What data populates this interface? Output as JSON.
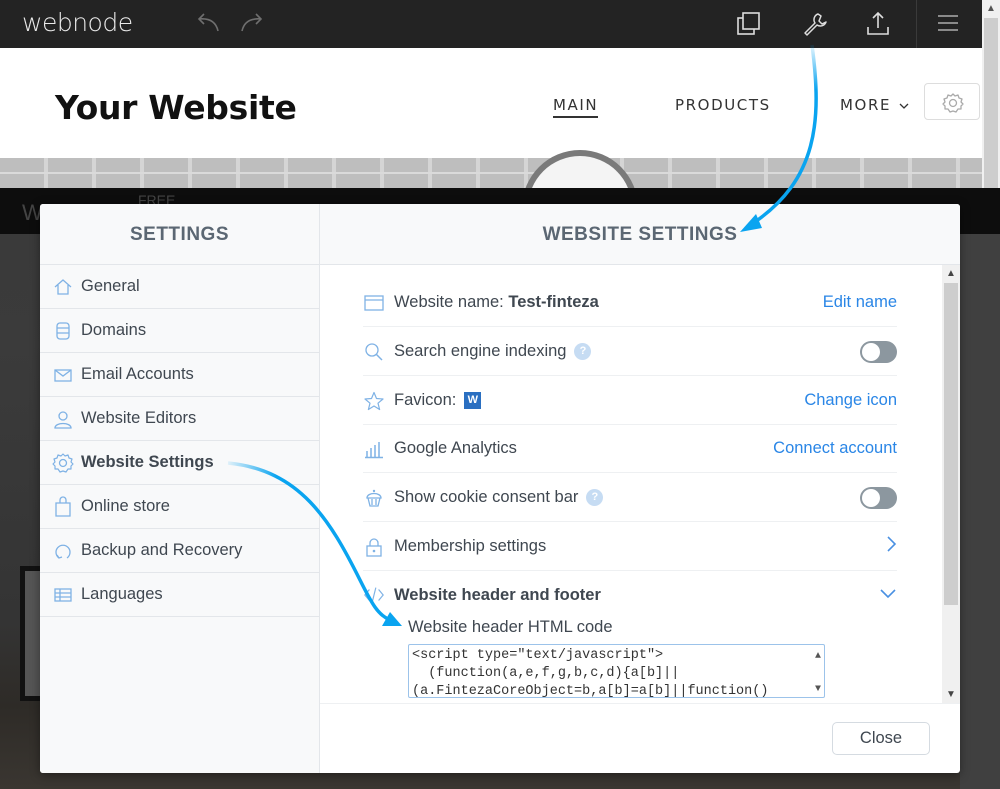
{
  "topbar": {
    "logo": "webnode",
    "icons": [
      "undo-icon",
      "redo-icon",
      "pages-icon",
      "wrench-icon",
      "publish-icon",
      "menu-icon"
    ]
  },
  "site": {
    "title": "Your Website",
    "nav": [
      {
        "label": "MAIN",
        "active": true
      },
      {
        "label": "PRODUCTS"
      },
      {
        "label": "MORE"
      }
    ]
  },
  "overlay": {
    "text": "W",
    "free": "FREE"
  },
  "sidebar": {
    "title": "SETTINGS",
    "items": [
      {
        "label": "General",
        "icon": "home-icon"
      },
      {
        "label": "Domains",
        "icon": "database-icon"
      },
      {
        "label": "Email Accounts",
        "icon": "envelope-icon"
      },
      {
        "label": "Website Editors",
        "icon": "user-icon"
      },
      {
        "label": "Website Settings",
        "icon": "gear-icon",
        "active": true
      },
      {
        "label": "Online store",
        "icon": "shopping-bag-icon"
      },
      {
        "label": "Backup and Recovery",
        "icon": "refresh-icon"
      },
      {
        "label": "Languages",
        "icon": "languages-icon"
      }
    ]
  },
  "main": {
    "title": "WEBSITE SETTINGS",
    "rows": {
      "website_name": {
        "label": "Website name:",
        "value": "Test-finteza",
        "action": "Edit name"
      },
      "search_indexing": {
        "label": "Search engine indexing",
        "help": "?",
        "toggle": false
      },
      "favicon": {
        "label": "Favicon:",
        "badge": "W",
        "action": "Change icon"
      },
      "analytics": {
        "label": "Google Analytics",
        "action": "Connect account"
      },
      "cookie_bar": {
        "label": "Show cookie consent bar",
        "help": "?",
        "toggle": false
      },
      "membership": {
        "label": "Membership settings"
      },
      "header_footer": {
        "label": "Website header and footer",
        "expanded": true
      }
    },
    "code": {
      "label": "Website header HTML code",
      "value": "<script type=\"text/javascript\">\n  (function(a,e,f,g,b,c,d){a[b]||\n(a.FintezaCoreObject=b,a[b]=a[b]||function()"
    },
    "close_label": "Close"
  },
  "colors": {
    "accent": "#2a86e6",
    "annotation_arrow": "#0aa4f0",
    "heading": "#5b6773",
    "text": "#3f4750"
  }
}
